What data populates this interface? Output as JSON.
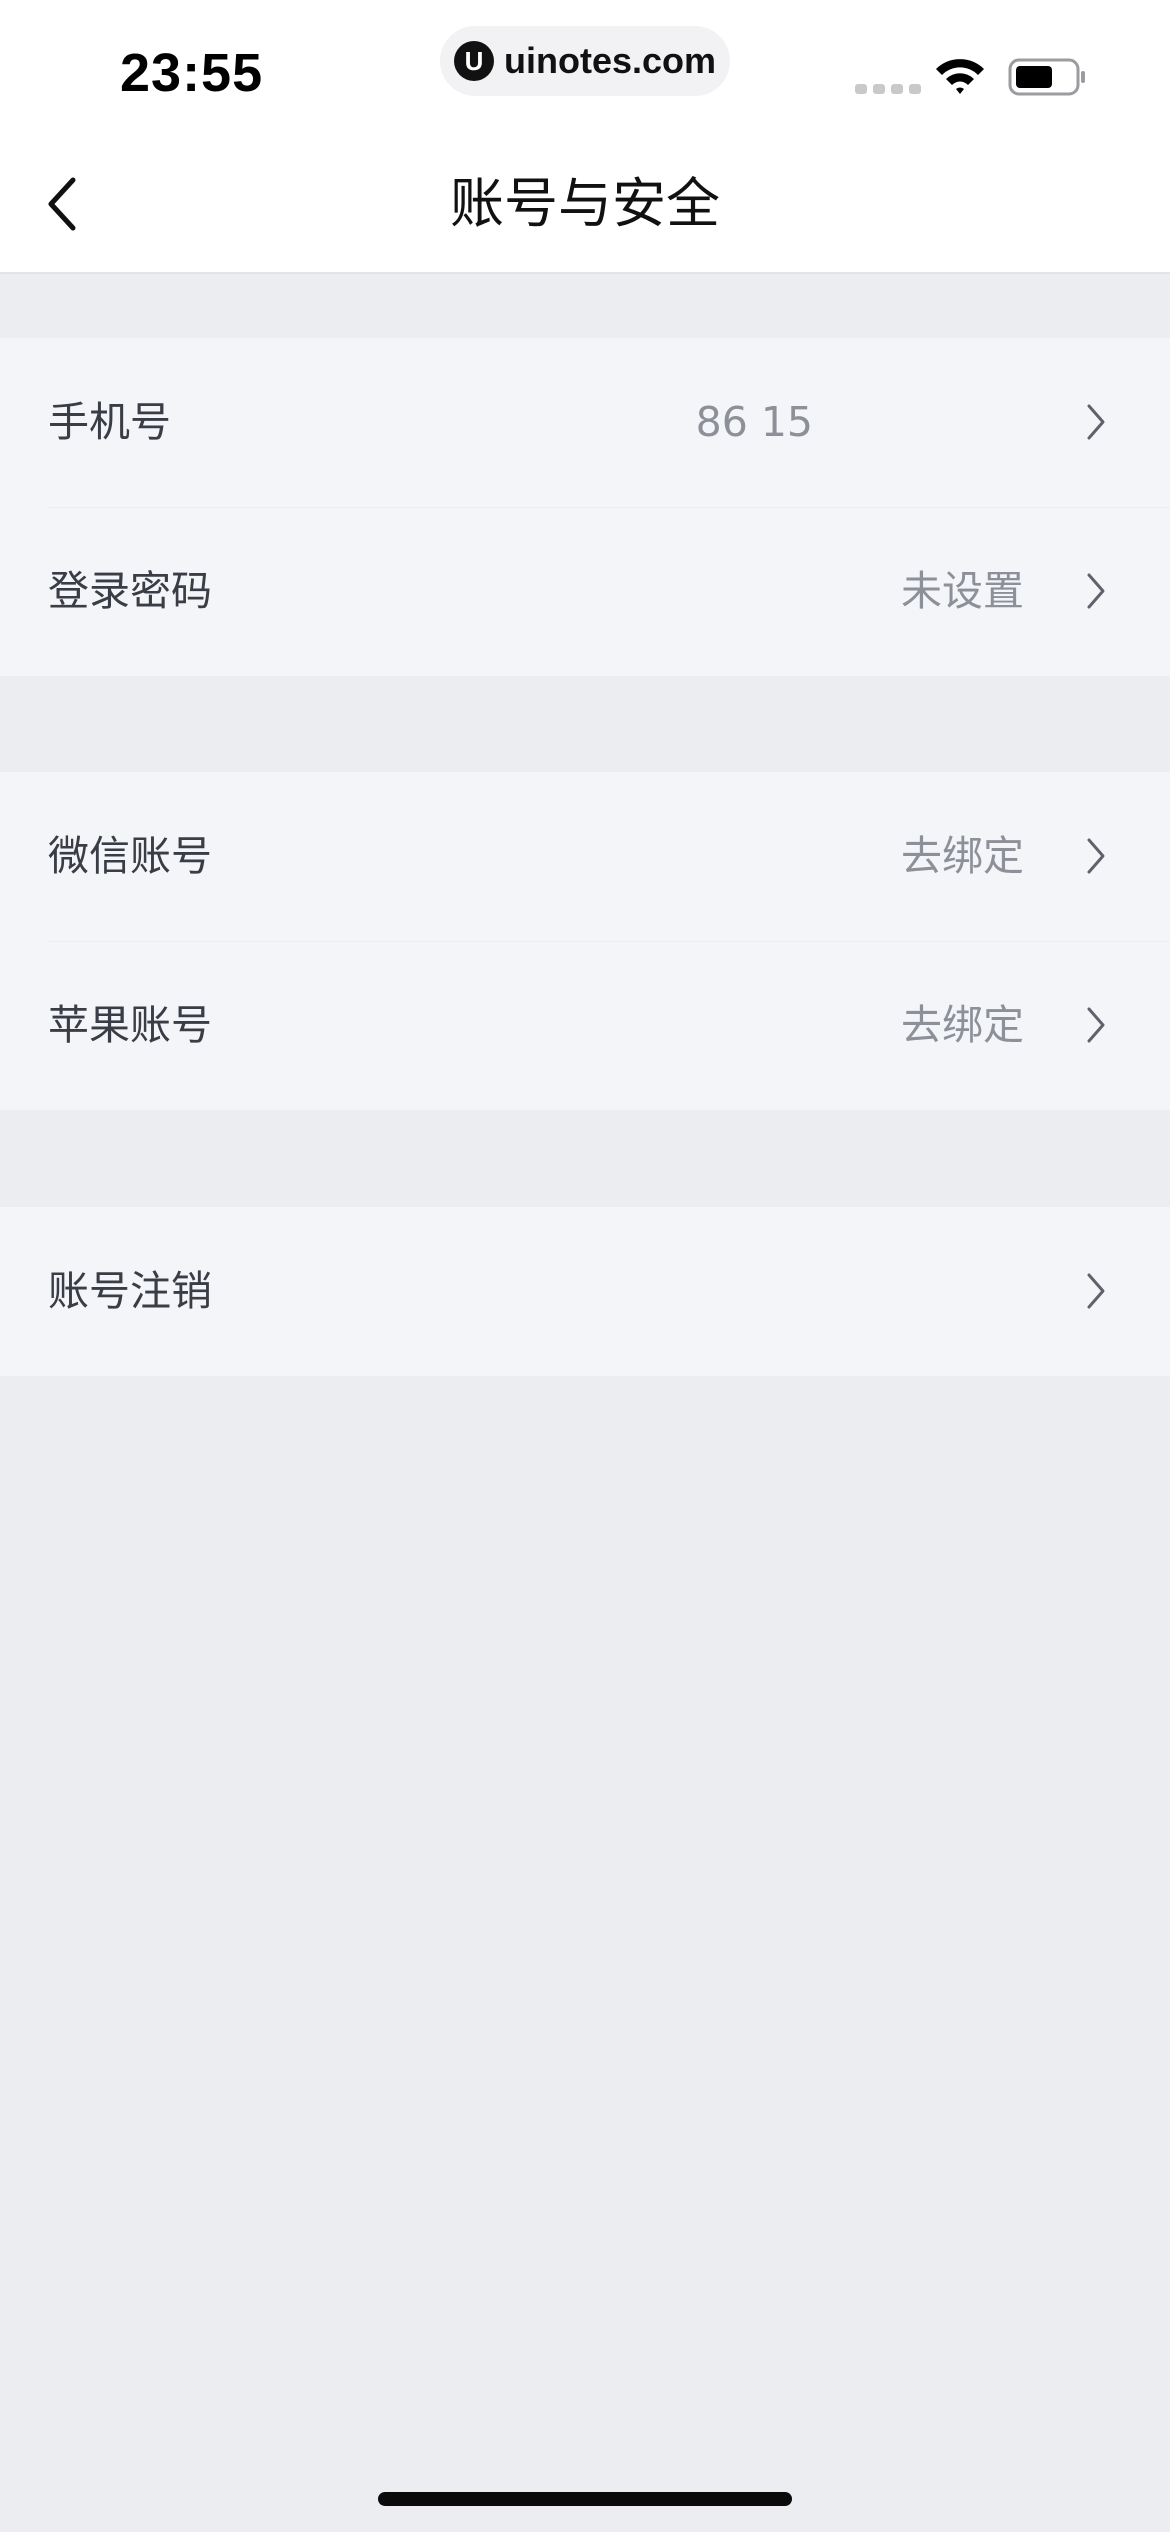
{
  "status_bar": {
    "time": "23:55",
    "url_logo": "U",
    "url": "uinotes.com",
    "icons": [
      "signal-icon",
      "wifi-icon",
      "battery-icon"
    ]
  },
  "nav": {
    "back_icon": "chevron-left-icon",
    "title": "账号与安全"
  },
  "groups": [
    {
      "rows": [
        {
          "label": "手机号",
          "value": "86 15",
          "chevron_icon": "chevron-right-icon"
        },
        {
          "label": "登录密码",
          "value": "未设置",
          "chevron_icon": "chevron-right-icon"
        }
      ]
    },
    {
      "rows": [
        {
          "label": "微信账号",
          "value": "去绑定",
          "chevron_icon": "chevron-right-icon"
        },
        {
          "label": "苹果账号",
          "value": "去绑定",
          "chevron_icon": "chevron-right-icon"
        }
      ]
    },
    {
      "rows": [
        {
          "label": "账号注销",
          "value": "",
          "chevron_icon": "chevron-right-icon"
        }
      ]
    }
  ],
  "colors": {
    "page_background": "#ecedf1",
    "row_background": "#f4f5f9",
    "label_text": "#3a3d45",
    "value_text": "#8d9098"
  }
}
